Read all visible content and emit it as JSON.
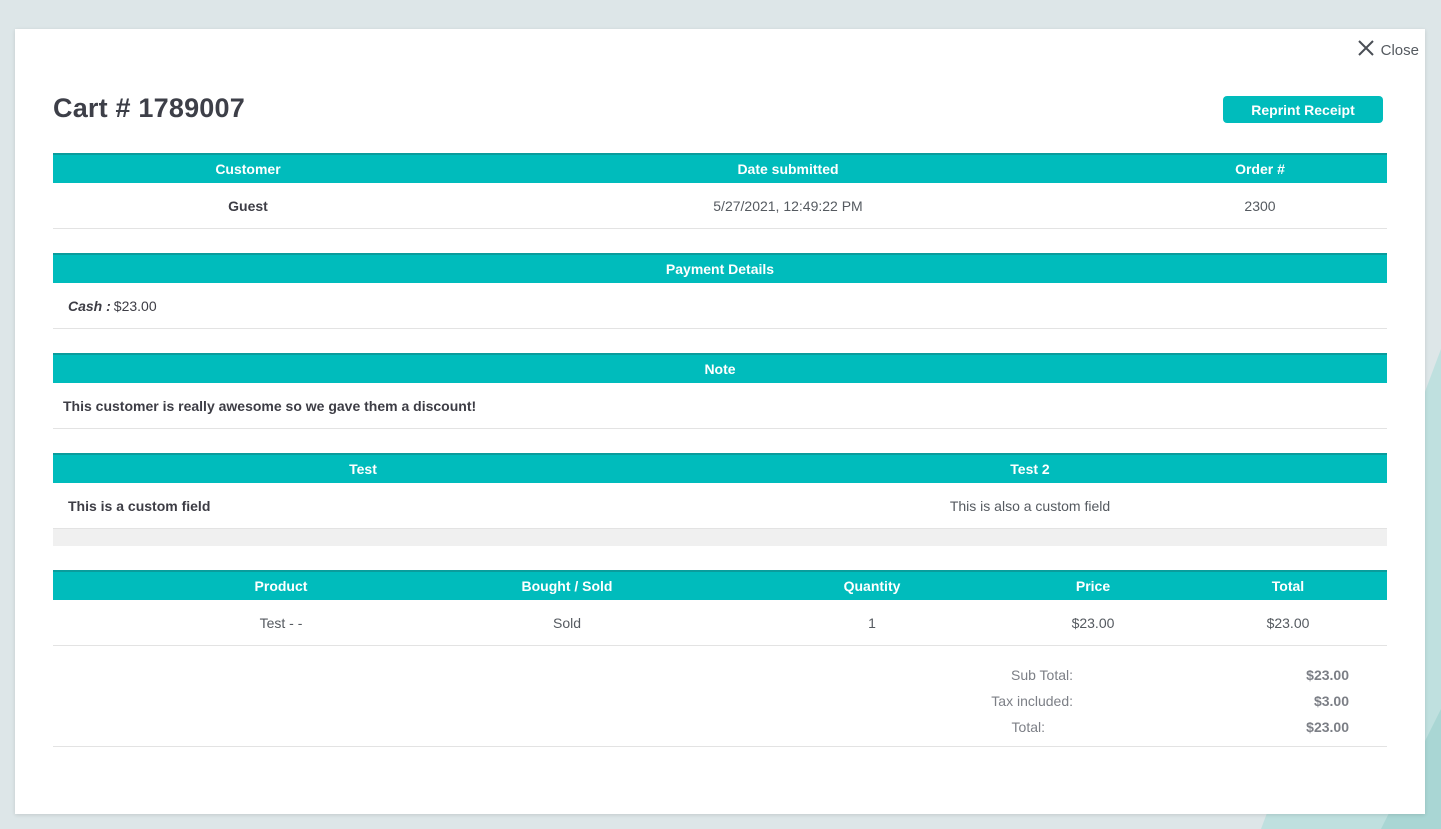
{
  "modal": {
    "close_label": "Close",
    "title": "Cart # 1789007",
    "reprint_label": "Reprint Receipt"
  },
  "order_info": {
    "headers": [
      "Customer",
      "Date submitted",
      "Order #"
    ],
    "customer": "Guest",
    "date_submitted": "5/27/2021, 12:49:22 PM",
    "order_number": "2300"
  },
  "payment": {
    "header": "Payment Details",
    "method": "Cash :",
    "amount": "$23.00"
  },
  "note": {
    "header": "Note",
    "text": "This customer is really awesome so we gave them a discount!"
  },
  "custom_fields": {
    "headers": [
      "Test",
      "Test 2"
    ],
    "values": [
      "This is a custom field",
      "This is also a custom field"
    ]
  },
  "products": {
    "headers": [
      "Product",
      "Bought / Sold",
      "Quantity",
      "Price",
      "Total"
    ],
    "rows": [
      {
        "product": "Test - -",
        "bought_sold": "Sold",
        "quantity": "1",
        "price": "$23.00",
        "total": "$23.00"
      }
    ]
  },
  "totals": {
    "sub_total_label": "Sub Total:",
    "sub_total": "$23.00",
    "tax_label": "Tax included:",
    "tax": "$3.00",
    "total_label": "Total:",
    "total": "$23.00"
  },
  "colors": {
    "accent": "#00bcbc",
    "background": "#dde6e8"
  },
  "icons": {
    "close": "close-icon"
  }
}
